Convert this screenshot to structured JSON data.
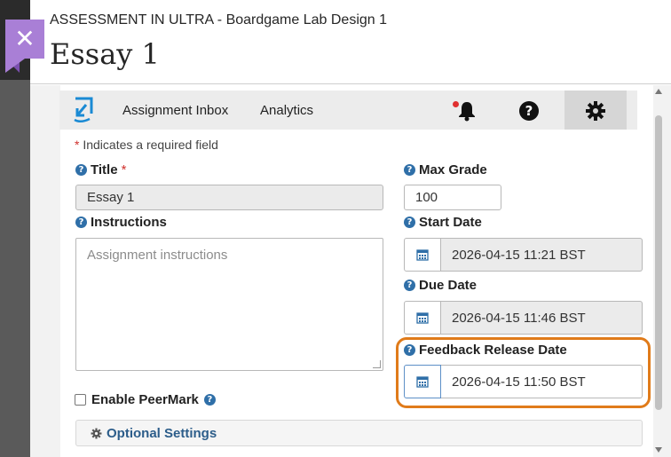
{
  "header": {
    "breadcrumb": "ASSESSMENT IN ULTRA - Boardgame Lab Design 1",
    "title": "Essay 1",
    "close_symbol": "✕"
  },
  "toolbar": {
    "logo_icon": "turnitin-logo-icon",
    "links": [
      "Assignment Inbox",
      "Analytics"
    ],
    "icons": [
      "bell-icon",
      "help-circle-icon",
      "gear-icon"
    ]
  },
  "form": {
    "required_note": "Indicates a required field",
    "required_star": "*",
    "title_label": "Title",
    "title_value": "Essay 1",
    "instructions_label": "Instructions",
    "instructions_placeholder": "Assignment instructions",
    "max_grade_label": "Max Grade",
    "max_grade_value": "100",
    "start_date_label": "Start Date",
    "start_date_value": "2026-04-15 11:21 BST",
    "due_date_label": "Due Date",
    "due_date_value": "2026-04-15 11:46 BST",
    "feedback_label": "Feedback Release Date",
    "feedback_value": "2026-04-15 11:50 BST",
    "peermark_label": "Enable PeerMark",
    "optional_settings_label": "Optional Settings"
  },
  "colors": {
    "highlight": "#e07b1a",
    "close_button": "#a97fd6",
    "link_blue": "#2c5d8a",
    "help_icon": "#2f6fa8"
  }
}
